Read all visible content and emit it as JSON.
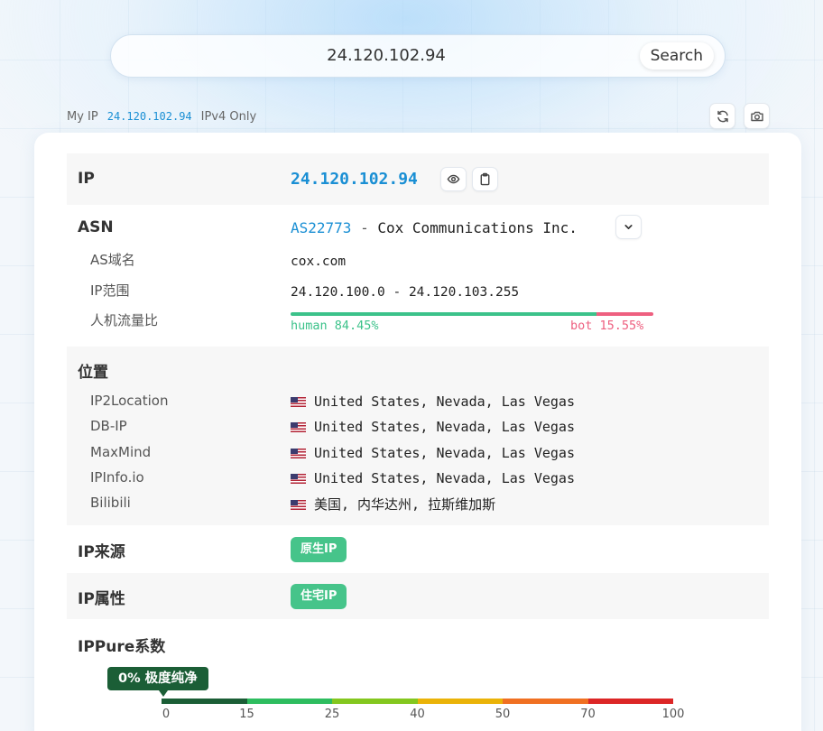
{
  "search": {
    "query": "24.120.102.94",
    "button_label": "Search"
  },
  "myip": {
    "label": "My IP",
    "value": "24.120.102.94",
    "mode": "IPv4 Only"
  },
  "toolbar": {
    "refresh_icon": "refresh-icon",
    "camera_icon": "camera-icon"
  },
  "ip_section": {
    "title": "IP",
    "value": "24.120.102.94",
    "eye_icon": "eye-icon",
    "copy_icon": "clipboard-icon"
  },
  "asn_section": {
    "title": "ASN",
    "asn": "AS22773",
    "separator": " - ",
    "org": "Cox Communications Inc.",
    "rows": [
      {
        "label": "AS域名",
        "value": "cox.com"
      },
      {
        "label": "IP范围",
        "value": "24.120.100.0 - 24.120.103.255"
      }
    ],
    "ratio": {
      "label": "人机流量比",
      "human_text": "human 84.45%",
      "bot_text": "bot 15.55%",
      "human_pct": 84.45,
      "bot_pct": 15.55,
      "human_color": "#3cc28a",
      "bot_color": "#ee6080"
    }
  },
  "location_section": {
    "title": "位置",
    "rows": [
      {
        "source": "IP2Location",
        "value": "United States, Nevada, Las Vegas"
      },
      {
        "source": "DB-IP",
        "value": "United States, Nevada, Las Vegas"
      },
      {
        "source": "MaxMind",
        "value": "United States, Nevada, Las Vegas"
      },
      {
        "source": "IPInfo.io",
        "value": "United States, Nevada, Las Vegas"
      },
      {
        "source": "Bilibili",
        "value": "美国, 内华达州, 拉斯维加斯"
      }
    ]
  },
  "source_section": {
    "title": "IP来源",
    "badge": "原生IP"
  },
  "type_section": {
    "title": "IP属性",
    "badge": "住宅IP"
  },
  "score_section": {
    "title": "IPPure系数",
    "score_label": "0% 极度纯净",
    "score_value": 0,
    "ticks": [
      "0",
      "15",
      "25",
      "40",
      "50",
      "70",
      "100"
    ],
    "segments": [
      {
        "from": 0,
        "to": 15,
        "color": "#1b5e36"
      },
      {
        "from": 15,
        "to": 25,
        "color": "#2ebd5f"
      },
      {
        "from": 25,
        "to": 40,
        "color": "#84c71f"
      },
      {
        "from": 40,
        "to": 50,
        "color": "#eab308"
      },
      {
        "from": 50,
        "to": 70,
        "color": "#f07022"
      },
      {
        "from": 70,
        "to": 100,
        "color": "#dc2626"
      }
    ]
  }
}
